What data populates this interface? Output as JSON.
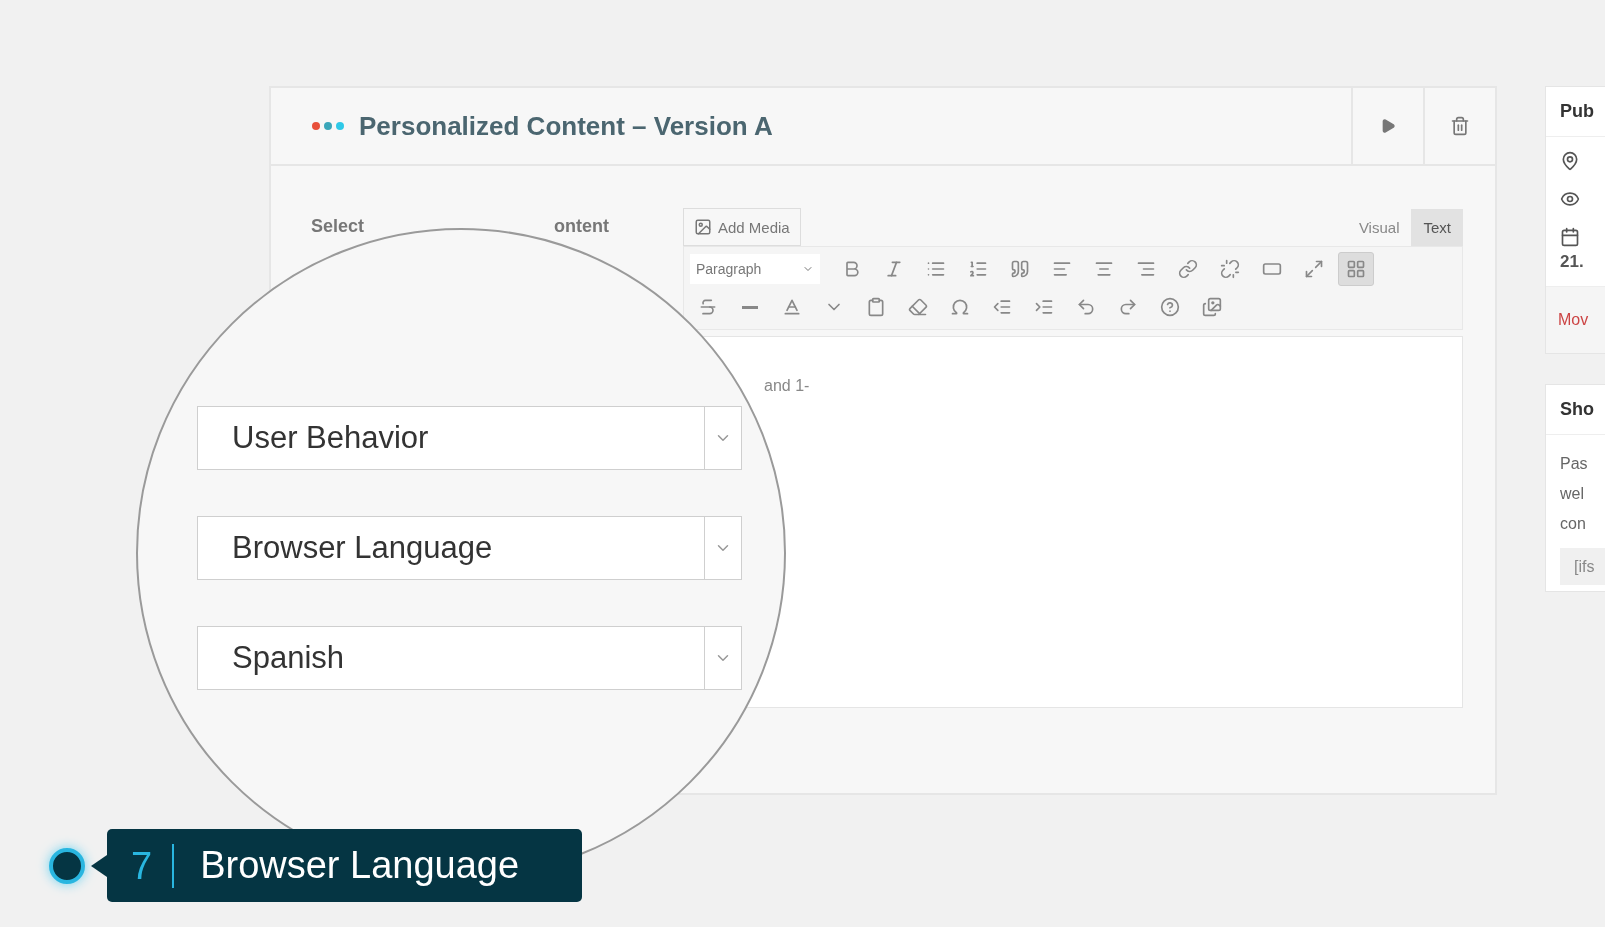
{
  "panel": {
    "title": "Personalized Content – Version A",
    "label_fragments": [
      "Select",
      "ontent"
    ],
    "add_media": "Add Media",
    "editor_tabs": [
      {
        "label": "Visual",
        "selected": false
      },
      {
        "label": "Text",
        "selected": true
      }
    ],
    "format_select": "Paragraph",
    "toolbar_toggle_on": true,
    "editor_text": "and 1-"
  },
  "sidebar": {
    "publish": {
      "title": "Pub",
      "date": "21.",
      "trash_link": "Mov"
    },
    "shortcode": {
      "title": "Sho",
      "lines": [
        "Pas",
        "wel",
        "con"
      ],
      "code": "[ifs"
    }
  },
  "magnifier": {
    "selects": [
      "User Behavior",
      "Browser Language",
      "Spanish"
    ]
  },
  "callout": {
    "number": "7",
    "label": "Browser Language"
  }
}
